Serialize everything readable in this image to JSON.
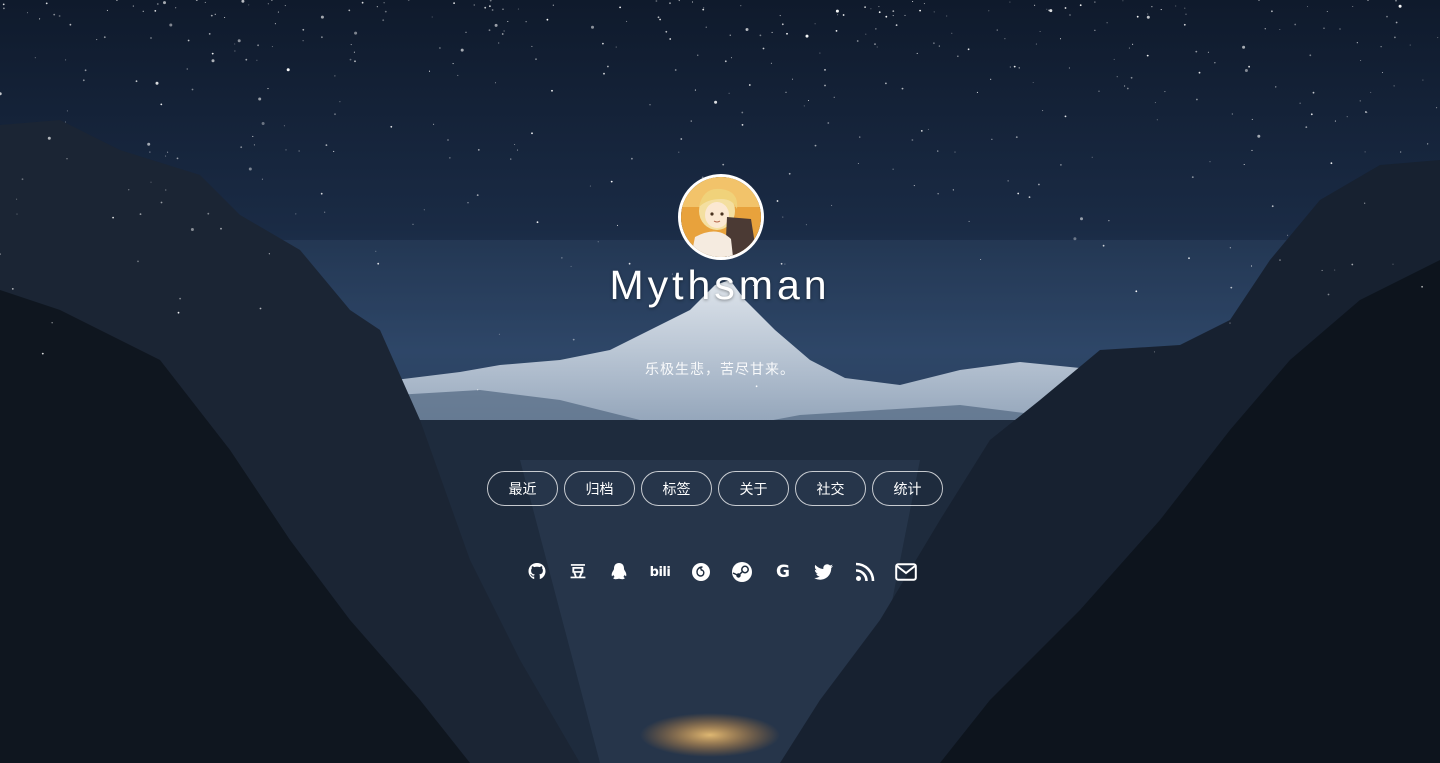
{
  "site": {
    "title": "Mythsman",
    "subtitle": "乐极生悲，苦尽甘来。"
  },
  "nav": [
    {
      "label": "最近"
    },
    {
      "label": "归档"
    },
    {
      "label": "标签"
    },
    {
      "label": "关于"
    },
    {
      "label": "社交"
    },
    {
      "label": "统计"
    }
  ],
  "social": [
    {
      "icon": "github-icon"
    },
    {
      "icon": "douban-icon",
      "glyph": "豆"
    },
    {
      "icon": "qq-icon"
    },
    {
      "icon": "bilibili-icon",
      "glyph": "bili"
    },
    {
      "icon": "netease-music-icon"
    },
    {
      "icon": "steam-icon"
    },
    {
      "icon": "google-icon",
      "glyph": "G"
    },
    {
      "icon": "twitter-icon"
    },
    {
      "icon": "rss-icon"
    },
    {
      "icon": "email-icon"
    }
  ],
  "colors": {
    "text": "#ffffff",
    "sky": "#1a2b45",
    "avatar_border": "#ffffff"
  }
}
